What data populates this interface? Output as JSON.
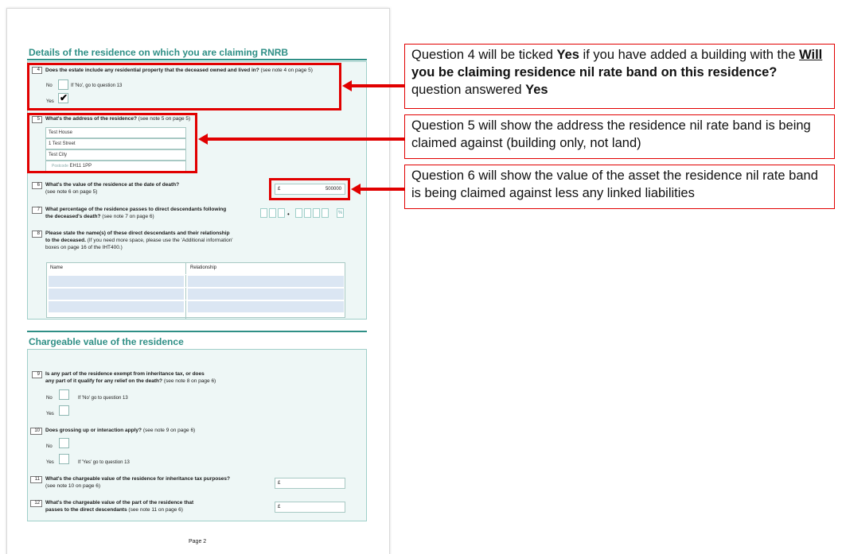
{
  "form": {
    "section1_title": "Details of the residence on which you are claiming RNRB",
    "section2_title": "Chargeable value of the residence",
    "page_label": "Page 2",
    "q4": {
      "num": "4",
      "text": "Does the estate include any residential property that the deceased owned and lived in?",
      "note": "(see note 4 on page 5)",
      "no_label": "No",
      "no_hint": "If 'No', go to question 13",
      "yes_label": "Yes",
      "yes_tick": "✔"
    },
    "q5": {
      "num": "5",
      "text": "What's the address of the residence?",
      "note": "(see note 5 on page 5)",
      "line1": "Test House",
      "line2": "1 Test Street",
      "line3": "Test City",
      "postcode_label": "Postcode",
      "postcode": "EH11 1PP"
    },
    "q6": {
      "num": "6",
      "text": "What's the value of the residence at the date of death?",
      "note": "(see note 6 on page 5)",
      "currency": "£",
      "value": "500000"
    },
    "q7": {
      "num": "7",
      "text_a": "What percentage of the residence passes to direct descendants following",
      "text_b": "the deceased's death?",
      "note": "(see note 7 on page 6)",
      "dot": "•",
      "percent": "%"
    },
    "q8": {
      "num": "8",
      "text_a": "Please state the name(s) of these direct descendants and their relationship",
      "text_b": "to the deceased.",
      "text_c": "(If you need more space, please use the 'Additional information'",
      "text_d": "boxes on page 16 of the IHT400.)",
      "col_name": "Name",
      "col_relationship": "Relationship"
    },
    "q9": {
      "num": "9",
      "text_a": "Is any part of the residence exempt from inheritance tax, or does",
      "text_b": "any part of it qualify for any relief on the death?",
      "note": "(see note 8 on page 6)",
      "no_label": "No",
      "no_hint": "If 'No' go to question 13",
      "yes_label": "Yes"
    },
    "q10": {
      "num": "10",
      "text": "Does grossing up or interaction apply?",
      "note": "(see note 9 on page 6)",
      "no_label": "No",
      "yes_label": "Yes",
      "yes_hint": "If 'Yes' go to question 13"
    },
    "q11": {
      "num": "11",
      "text": "What's the chargeable value of the residence for inheritance tax purposes?",
      "note": "(see note 10 on page 6)",
      "currency": "£"
    },
    "q12": {
      "num": "12",
      "text_a": "What's the chargeable value of the part of the residence that",
      "text_b": "passes to the direct descendants",
      "note": "(see note 11 on page 6)",
      "currency": "£"
    }
  },
  "callouts": {
    "c1": {
      "p1": "Question 4 will be ticked ",
      "b1": "Yes",
      "p2": " if you have added a building with the ",
      "u1": "Will",
      "b2": " you be claiming residence nil rate band on this residence?",
      "p3": " question answered ",
      "b3": "Yes"
    },
    "c2": "Question 5 will show the address the residence nil rate band is being claimed against (building only, not land)",
    "c3": "Question 6 will show the value of the asset the residence nil rate band is being claimed against less any linked liabilities"
  },
  "colors": {
    "accent": "#2f8f86",
    "highlight": "#e10000"
  }
}
